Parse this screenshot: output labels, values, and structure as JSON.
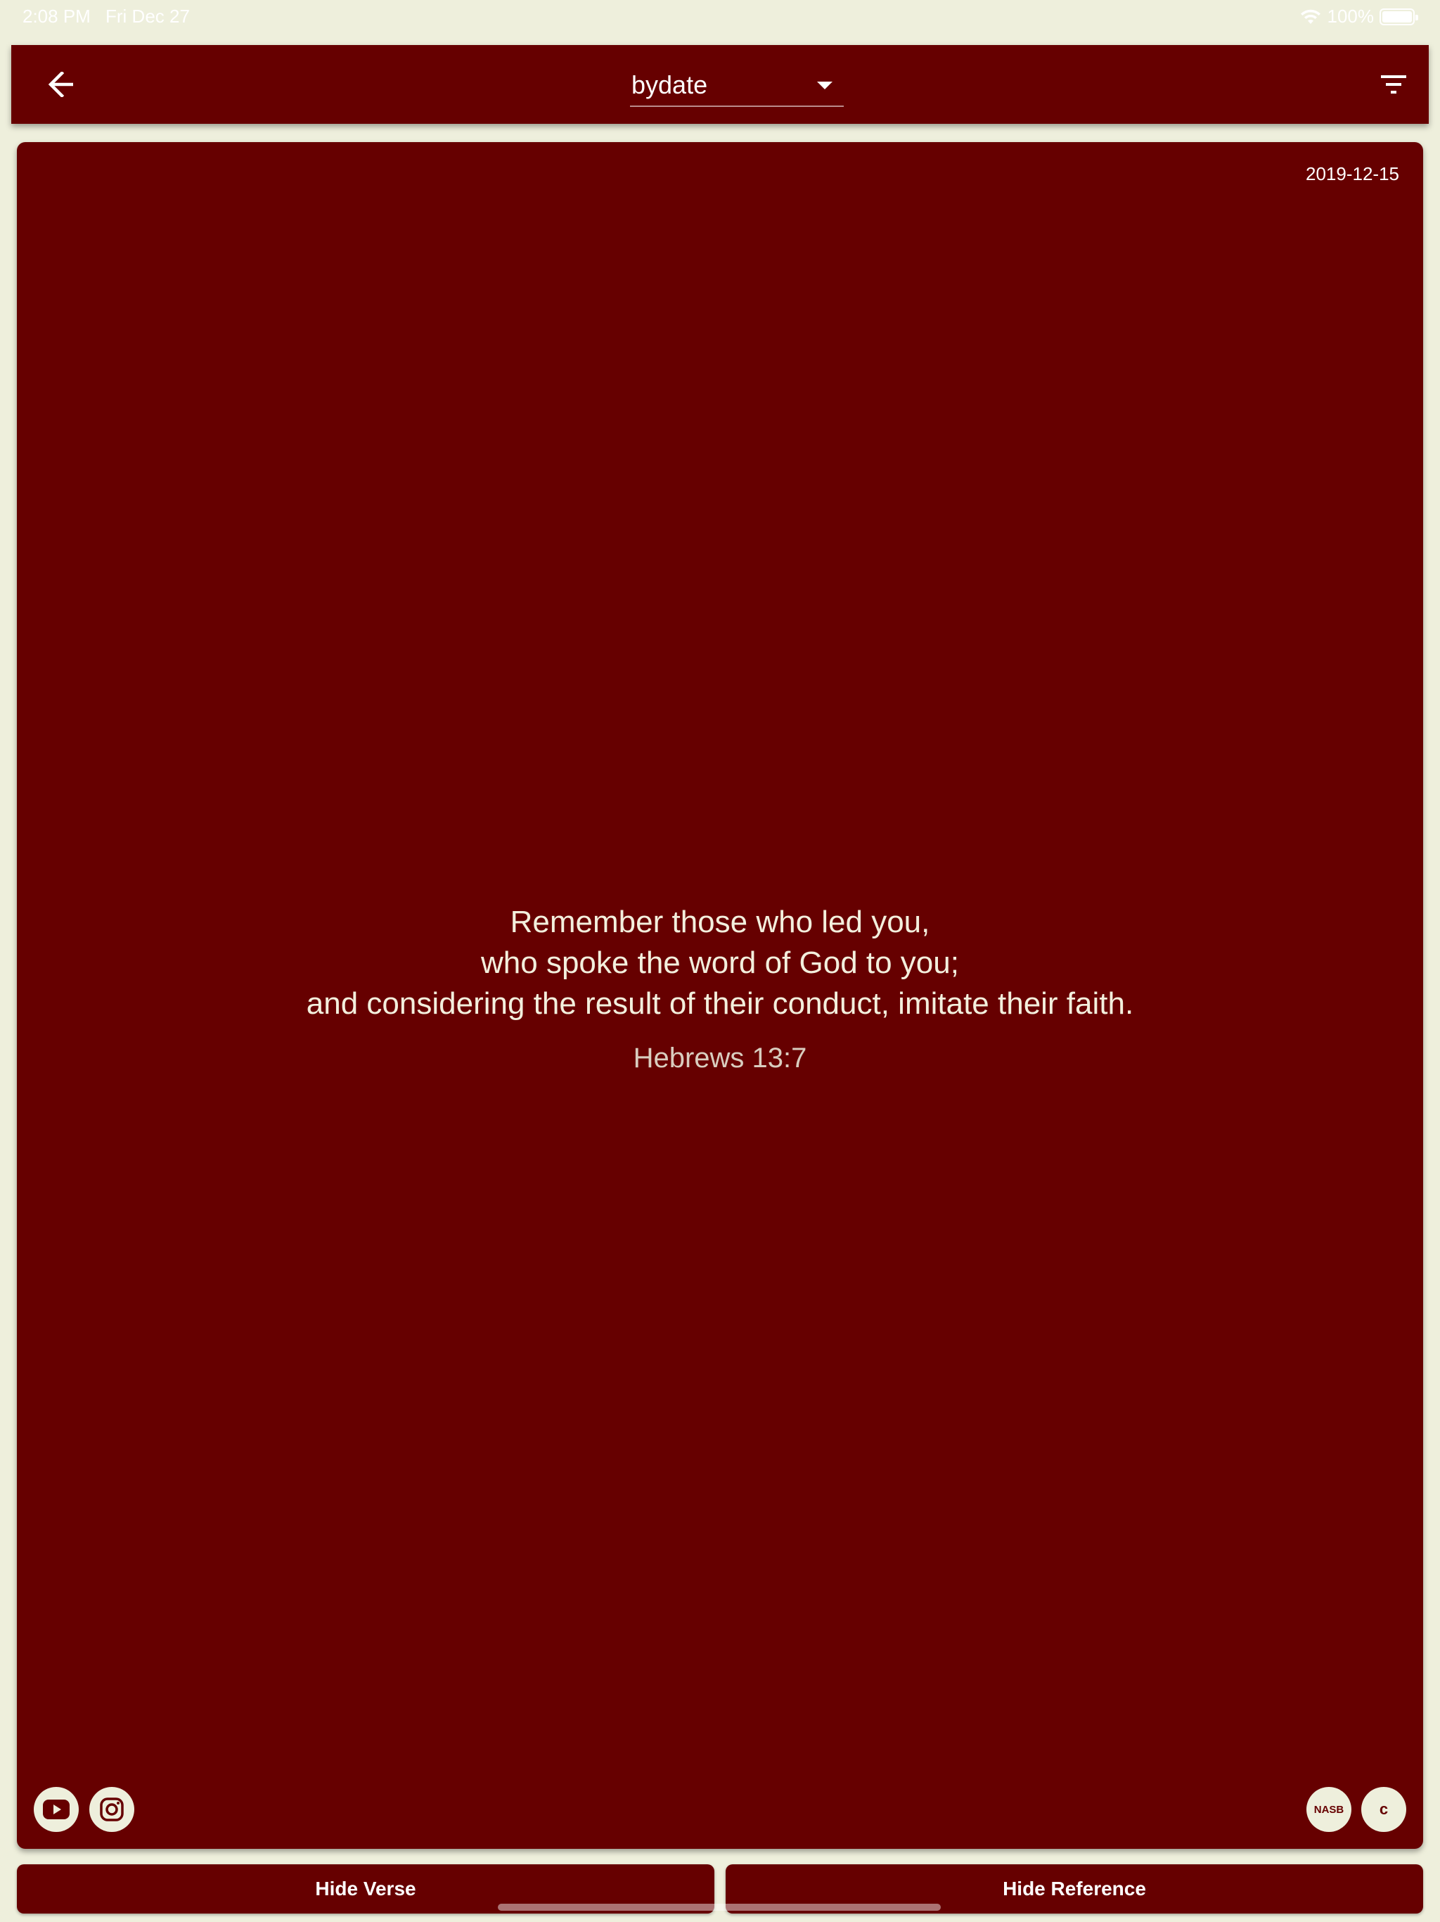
{
  "status_bar": {
    "time": "2:08 PM",
    "date": "Fri Dec 27",
    "battery": "100%",
    "battery_level": 1.0
  },
  "app_bar": {
    "back_icon": "arrow-left-icon",
    "dropdown_value": "bydate",
    "filter_icon": "filter-list-icon"
  },
  "card": {
    "date": "2019-12-15",
    "verse_lines": [
      "Remember those who led you,",
      "who spoke the word of God to you;",
      "and considering the result of their conduct, imitate their faith."
    ],
    "reference": "Hebrews 13:7",
    "version_label": "NASB",
    "c_label": "c",
    "social_icons": [
      "youtube-icon",
      "instagram-icon"
    ]
  },
  "bottom_buttons": {
    "hide_verse": "Hide Verse",
    "hide_reference": "Hide Reference"
  },
  "colors": {
    "background": "#eeefdc",
    "primary": "#660000",
    "verse_text": "#f3efdd",
    "reference_text": "#d9cdbf"
  }
}
